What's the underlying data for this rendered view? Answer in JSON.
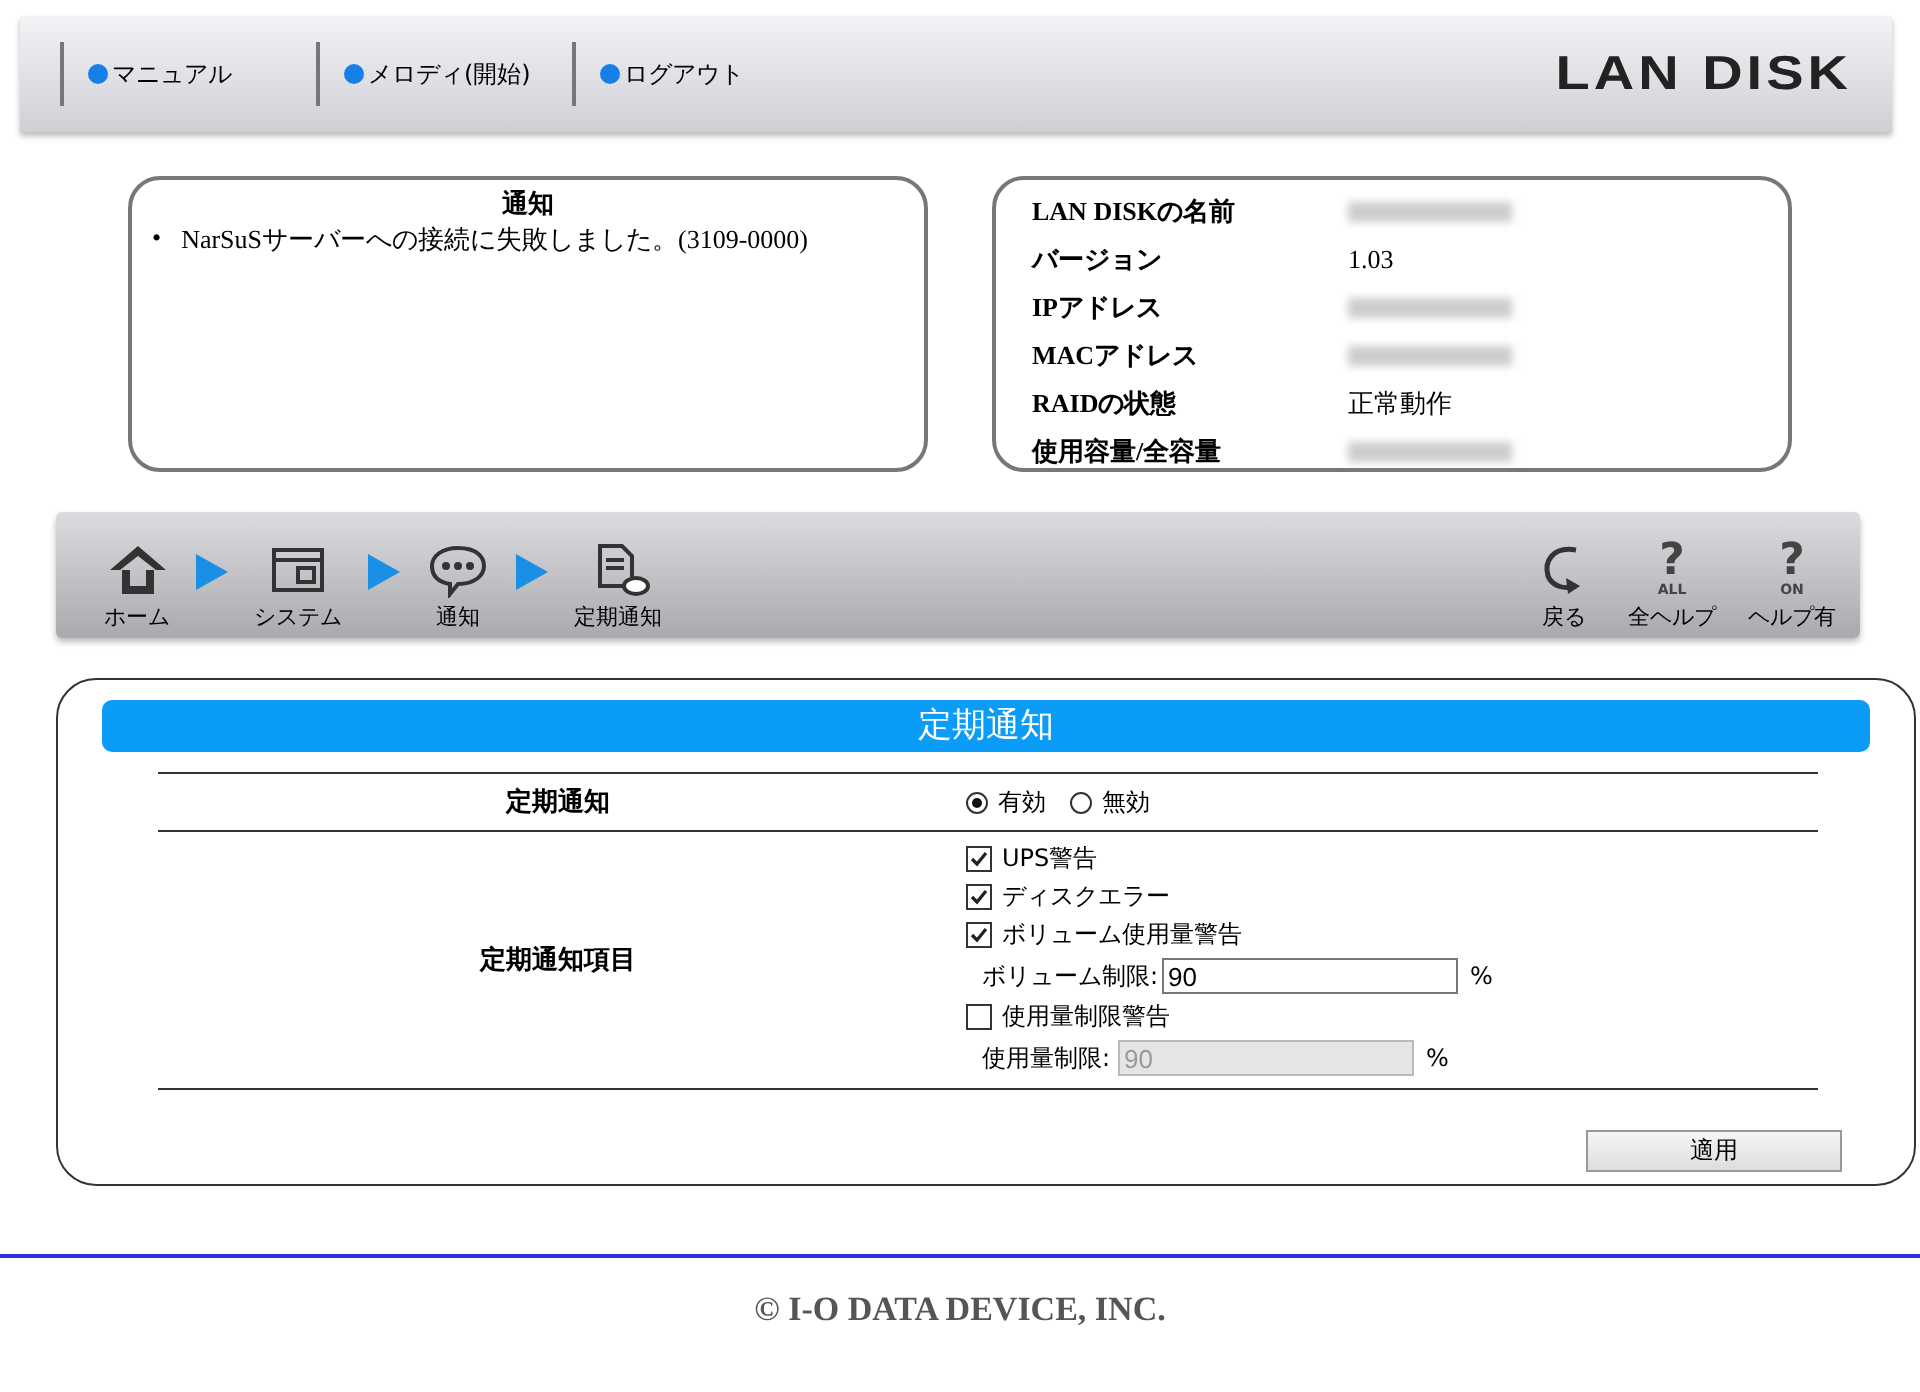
{
  "header": {
    "links": [
      {
        "label": "マニュアル"
      },
      {
        "label": "メロディ(開始)"
      },
      {
        "label": "ログアウト"
      }
    ],
    "logo": "LAN DISK"
  },
  "notice": {
    "title": "通知",
    "items": [
      {
        "bullet": "•",
        "text": "NarSuSサーバーへの接続に失敗しました。(3109-0000)"
      }
    ]
  },
  "info": [
    {
      "label": "LAN DISKの名前",
      "blurred": true
    },
    {
      "label": "バージョン",
      "value": "1.03"
    },
    {
      "label": "IPアドレス",
      "blurred": true
    },
    {
      "label": "MACアドレス",
      "blurred": true
    },
    {
      "label": "RAIDの状態",
      "value": "正常動作"
    },
    {
      "label": "使用容量/全容量",
      "blurred": true
    }
  ],
  "toolbar": {
    "breadcrumbs": [
      {
        "kind": "home",
        "label": "ホーム"
      },
      {
        "kind": "window",
        "label": "システム"
      },
      {
        "kind": "chat",
        "label": "通知"
      },
      {
        "kind": "document",
        "label": "定期通知"
      }
    ],
    "actions": [
      {
        "kind": "back",
        "label": "戻る"
      },
      {
        "kind": "help",
        "glyph": "?",
        "badge": "ALL",
        "label": "全ヘルプ"
      },
      {
        "kind": "help",
        "glyph": "?",
        "badge": "ON",
        "label": "ヘルプ有"
      }
    ]
  },
  "section": {
    "title": "定期通知",
    "rows": [
      {
        "kind": "radio",
        "label": "定期通知",
        "options": [
          {
            "label": "有効",
            "selected": true
          },
          {
            "label": "無効",
            "selected": false
          }
        ]
      },
      {
        "kind": "list",
        "label": "定期通知項目",
        "items": [
          {
            "kind": "checkbox",
            "label": "UPS警告",
            "checked": true
          },
          {
            "kind": "checkbox",
            "label": "ディスクエラー",
            "checked": true
          },
          {
            "kind": "checkbox",
            "label": "ボリューム使用量警告",
            "checked": true
          },
          {
            "kind": "limit",
            "label": "ボリューム制限:",
            "value": "90",
            "unit": "%",
            "disabled": false
          },
          {
            "kind": "checkbox",
            "label": "使用量制限警告",
            "checked": false
          },
          {
            "kind": "limit",
            "label": "使用量制限:",
            "value": "90",
            "unit": "%",
            "disabled": true
          }
        ]
      }
    ],
    "apply": "適用"
  },
  "footer": "© I-O DATA DEVICE, INC."
}
